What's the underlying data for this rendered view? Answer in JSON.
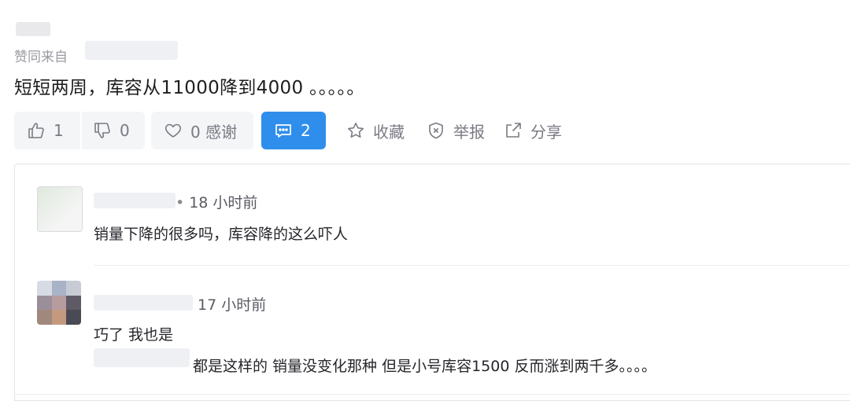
{
  "post": {
    "source_label": "赞同来自",
    "content": "短短两周，库容从11000降到4000 。。。。。"
  },
  "actions": {
    "like_count": "1",
    "dislike_count": "0",
    "thanks_label": "0 感谢",
    "comment_count": "2",
    "favorite_label": "收藏",
    "report_label": "举报",
    "share_label": "分享"
  },
  "colors": {
    "accent": "#2f8eec",
    "muted_text": "#7a7a84",
    "button_bg": "#f4f5f7"
  },
  "comments": [
    {
      "time": "18 小时前",
      "text": "销量下降的很多吗，库容降的这么吓人"
    },
    {
      "time": "17 小时前",
      "text": "巧了 我也是",
      "reply_text": "都是这样的 销量没变化那种 但是小号库容1500 反而涨到两千多。。。。"
    }
  ]
}
